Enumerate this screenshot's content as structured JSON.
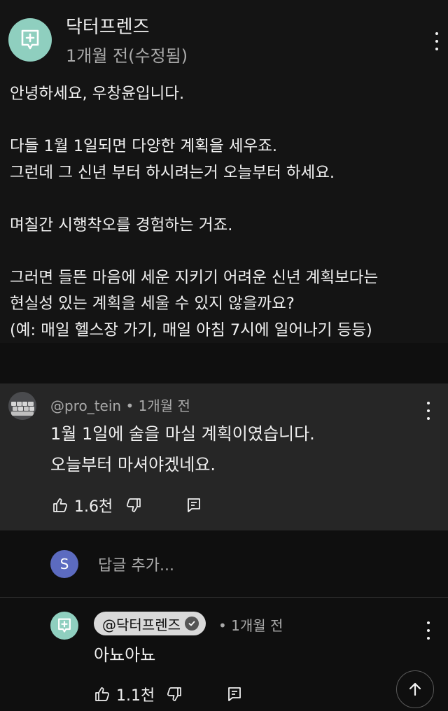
{
  "post": {
    "channel_name": "닥터프렌즈",
    "meta": "1개월 전(수정됨)",
    "avatar_icon": "plus-chat-icon",
    "lines": [
      "안녕하세요, 우창윤입니다.",
      "",
      "다들 1월 1일되면 다양한 계획을 세우죠.",
      "그런데 그 신년 부터 하시려는거 오늘부터 하세요.",
      "",
      "며칠간 시행착오를 경험하는 거죠.",
      "",
      "그러면 들뜬 마음에 세운 지키기 어려운 신년 계획보다는",
      "현실성 있는 계획을 세울 수 있지 않을까요?",
      "(예: 매일 헬스장 가기, 매일 아침 7시에 일어나기 등등)"
    ]
  },
  "comment": {
    "meta": "@pro_tein • 1개월 전",
    "lines": [
      "1월 1일에 술을 마실 계획이였습니다.",
      "오늘부터 마셔야겠네요."
    ],
    "like_count": "1.6천"
  },
  "reply_input": {
    "avatar_letter": "S",
    "placeholder": "답글 추가..."
  },
  "reply": {
    "author": "@닥터프렌즈",
    "time": "• 1개월 전",
    "text": "아뇨아뇨",
    "like_count": "1.1천"
  },
  "colors": {
    "background": "#0f0f0f",
    "post_bg": "#141414",
    "comment_bg": "#262626",
    "brand_avatar": "#8fcfbf",
    "user_avatar": "#5c6bc0"
  }
}
